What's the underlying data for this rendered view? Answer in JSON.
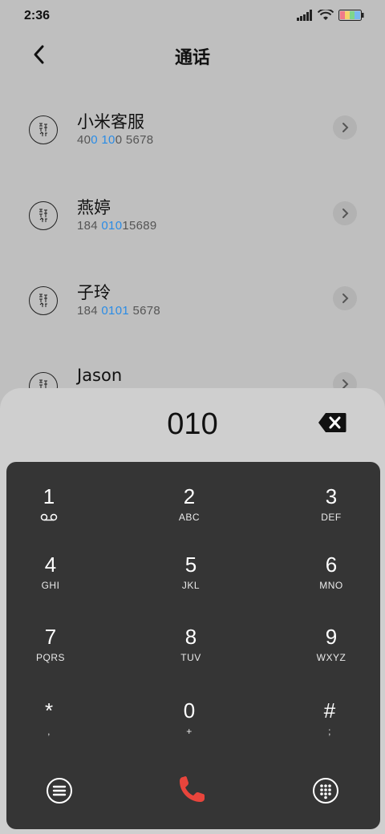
{
  "status": {
    "time": "2:36"
  },
  "header": {
    "title": "通话"
  },
  "contacts": [
    {
      "name": "小米客服",
      "number_parts": [
        "40",
        "0 10",
        "0 5678"
      ]
    },
    {
      "name": "燕婷",
      "number_parts": [
        "184 ",
        "010",
        "15689"
      ]
    },
    {
      "name": "子玲",
      "number_parts": [
        "184 ",
        "0101",
        " 5678"
      ]
    },
    {
      "name": "Jason",
      "number_parts": [
        "",
        "",
        ""
      ]
    }
  ],
  "dialer": {
    "input": "010",
    "keys": [
      {
        "num": "1",
        "letters": ""
      },
      {
        "num": "2",
        "letters": "ABC"
      },
      {
        "num": "3",
        "letters": "DEF"
      },
      {
        "num": "4",
        "letters": "GHI"
      },
      {
        "num": "5",
        "letters": "JKL"
      },
      {
        "num": "6",
        "letters": "MNO"
      },
      {
        "num": "7",
        "letters": "PQRS"
      },
      {
        "num": "8",
        "letters": "TUV"
      },
      {
        "num": "9",
        "letters": "WXYZ"
      },
      {
        "num": "*",
        "letters": ","
      },
      {
        "num": "0",
        "letters": "+"
      },
      {
        "num": "#",
        "letters": ";"
      }
    ]
  },
  "colors": {
    "accent": "#2a8ce6",
    "call": "#e8453c",
    "pad": "#353535"
  },
  "icons": [
    "back-icon",
    "chevron-right-icon",
    "backspace-icon",
    "voicemail-icon",
    "menu-icon",
    "call-icon",
    "dialpad-icon"
  ]
}
